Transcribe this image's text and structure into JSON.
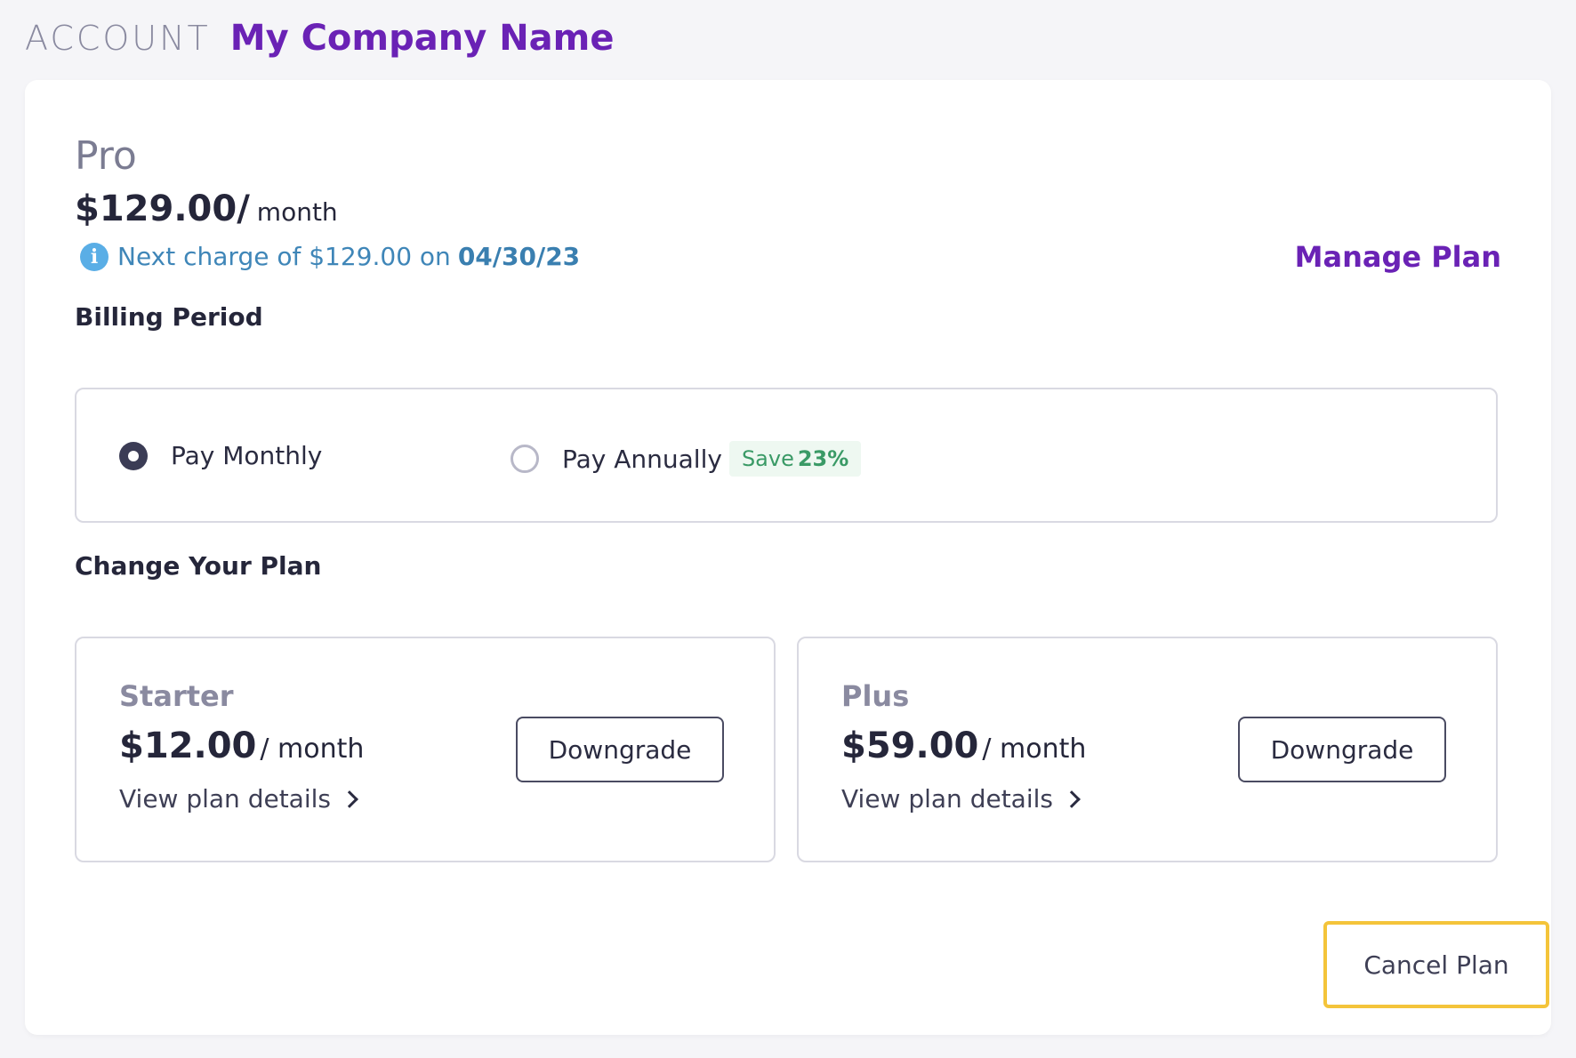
{
  "header": {
    "section": "ACCOUNT",
    "company": "My Company Name"
  },
  "current_plan": {
    "name": "Pro",
    "price": "$129.00/",
    "period": "month",
    "next_charge_text": "Next charge of $129.00 on",
    "next_charge_date": "04/30/23",
    "manage_label": "Manage Plan"
  },
  "billing": {
    "label": "Billing Period",
    "monthly_label": "Pay Monthly",
    "annually_label": "Pay Annually",
    "save_prefix": "Save",
    "save_value": "23%",
    "selected": "monthly"
  },
  "change_plan": {
    "label": "Change Your Plan",
    "plans": [
      {
        "name": "Starter",
        "price": "$12.00",
        "period": "/ month",
        "details": "View plan details",
        "action": "Downgrade"
      },
      {
        "name": "Plus",
        "price": "$59.00",
        "period": "/ month",
        "details": "View plan details",
        "action": "Downgrade"
      }
    ]
  },
  "cancel_label": "Cancel Plan",
  "colors": {
    "brand": "#6a22b5",
    "info": "#5aaee6",
    "save_green": "#3a9a66",
    "focus_outline": "#f4c43a"
  }
}
